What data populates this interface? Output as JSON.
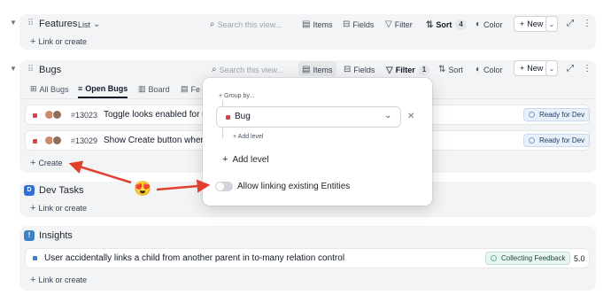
{
  "features": {
    "title": "Features",
    "view": "List",
    "search_placeholder": "Search this view...",
    "items_label": "Items",
    "fields_label": "Fields",
    "filter_label": "Filter",
    "sort_label": "Sort",
    "sort_count": "4",
    "color_label": "Color",
    "new_label": "New",
    "link_create": "Link or create"
  },
  "bugs": {
    "title": "Bugs",
    "search_placeholder": "Search this view...",
    "items_label": "Items",
    "fields_label": "Fields",
    "filter_label": "Filter",
    "filter_count": "1",
    "sort_label": "Sort",
    "color_label": "Color",
    "new_label": "New",
    "tabs": [
      "All Bugs",
      "Open Bugs",
      "Board",
      "Fe"
    ],
    "rows": [
      {
        "id": "13023",
        "text": "Toggle looks enabled for u",
        "status": "Ready for Dev"
      },
      {
        "id": "13029",
        "text": "Show Create button when",
        "status": "Ready for Dev"
      }
    ],
    "create_label": "Create"
  },
  "popup": {
    "group_by_label": "Group by...",
    "group_value": "Bug",
    "add_level_small": "Add level",
    "add_level": "Add level",
    "toggle_label": "Allow linking existing Entities"
  },
  "dev_tasks": {
    "title": "Dev Tasks",
    "link_create": "Link or create"
  },
  "insights": {
    "title": "Insights",
    "row_text": "User accidentally links a child from another parent in to-many relation control",
    "row_status": "Collecting Feedback",
    "row_score": "5.0",
    "link_create": "Link or create"
  },
  "colors": {
    "bug_red": "#d9434a",
    "accent_blue": "#2f6fd6",
    "arrow_red": "#e2402f"
  },
  "icons": {
    "emoji": "😍"
  }
}
